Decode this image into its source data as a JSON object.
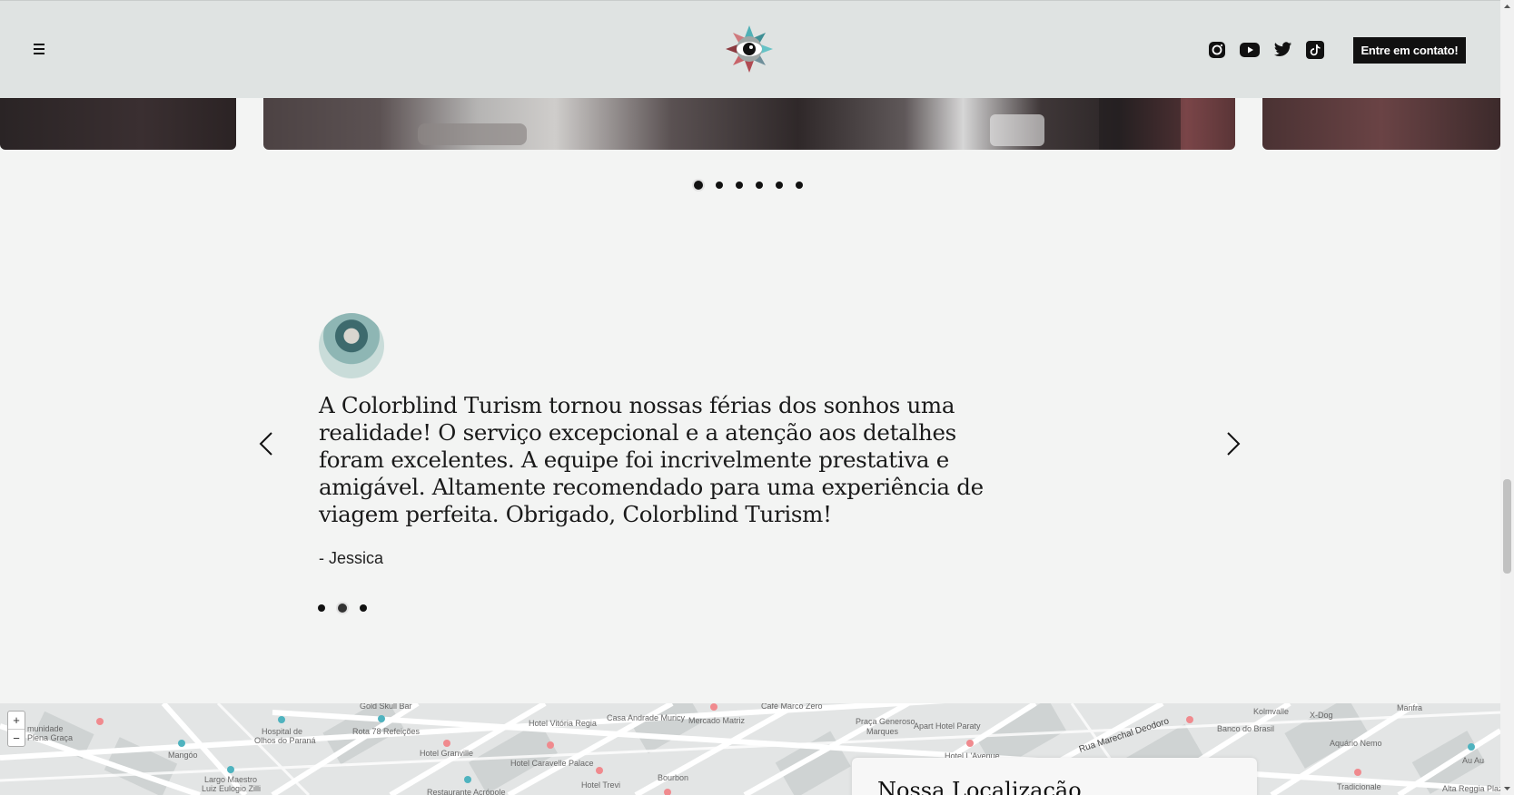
{
  "header": {
    "cta_label": "Entre em contato!",
    "menu_icon": "hamburger-icon",
    "logo_icon": "eye-logo-icon",
    "socials": [
      "instagram-icon",
      "youtube-icon",
      "twitter-icon",
      "tiktok-icon"
    ]
  },
  "carousel": {
    "slide_count": 6,
    "active_index": 0
  },
  "testimonial": {
    "quote": "A Colorblind Turism tornou nossas férias dos sonhos uma realidade! O serviço excepcional e a atenção aos detalhes foram excelentes. A equipe foi incrivelmente prestativa e amigável. Altamente recomendado para uma experiência de viagem perfeita. Obrigado, Colorblind Turism!",
    "author": "- Jessica",
    "slide_count": 3,
    "active_index": 1
  },
  "map": {
    "zoom_in": "+",
    "zoom_out": "−",
    "labels": [
      "munidade",
      "Plena Graça",
      "Mangóo",
      "Largo Maestro",
      "Luiz Eulogio Zilli",
      "Hospital de",
      "Olhos do Paraná",
      "Gold Skull Bar",
      "Rota 78 Refeições",
      "Hotel Granville",
      "Restaurante Acrópole",
      "Hotel Vitória Regia",
      "Hotel Caravelle Palace",
      "Casa Andrade Muricy",
      "Mercado Matriz",
      "Bourbon",
      "Hotel Trevi",
      "Café Marco Zero",
      "Praça Generoso",
      "Marques",
      "Apart Hotel Paraty",
      "Hotel L'Avenue",
      "Rua Marechal Deodoro",
      "Banco do Brasil",
      "Kolmvalle",
      "X-Dog",
      "Aquário Nemo",
      "Manfra",
      "Au Au",
      "Tradicionale",
      "Alta Reggia Plaza"
    ],
    "card_title": "Nossa Localização"
  }
}
